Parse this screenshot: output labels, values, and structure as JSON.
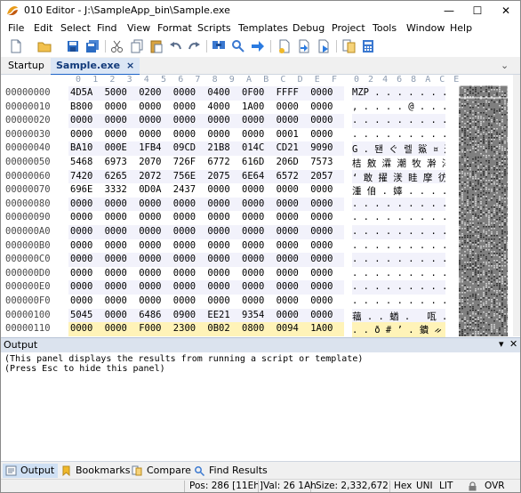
{
  "window": {
    "title": "010 Editor - J:\\SampleApp_bin\\Sample.exe",
    "minimize_glyph": "—",
    "maximize_glyph": "☐",
    "close_glyph": "✕"
  },
  "menu": [
    "File",
    "Edit",
    "Select",
    "Find",
    "View",
    "Format",
    "Scripts",
    "Templates",
    "Debug",
    "Project",
    "Tools",
    "Window",
    "Help"
  ],
  "toolbar_icons": [
    "new-file-icon",
    "open-folder-icon",
    "save-icon",
    "save-all-icon",
    "cut-icon",
    "copy-icon",
    "paste-icon",
    "undo-icon",
    "redo-icon",
    "find-icon",
    "find-in-files-icon",
    "goto-icon",
    "insert-template-icon",
    "run-template-icon",
    "run-script-icon",
    "compare-icon",
    "calculator-icon"
  ],
  "tabs": {
    "startup": "Startup",
    "active": "Sample.exe",
    "close_glyph": "×",
    "chevron": "⌄"
  },
  "hex": {
    "column_header": [
      "0",
      "1",
      "2",
      "3",
      "4",
      "5",
      "6",
      "7",
      "8",
      "9",
      "A",
      "B",
      "C",
      "D",
      "E",
      "F"
    ],
    "text_header": "0 2 4 6 8 A C E",
    "rows": [
      {
        "addr": "00000000",
        "words": [
          "4D5A",
          "5000",
          "0200",
          "0000",
          "0400",
          "0F00",
          "FFFF",
          "0000"
        ],
        "text": "MZP . . . . . . ."
      },
      {
        "addr": "00000010",
        "words": [
          "B800",
          "0000",
          "0000",
          "0000",
          "4000",
          "1A00",
          "0000",
          "0000"
        ],
        "text": ", . . . . @ . . . ."
      },
      {
        "addr": "00000020",
        "words": [
          "0000",
          "0000",
          "0000",
          "0000",
          "0000",
          "0000",
          "0000",
          "0000"
        ],
        "text": ". . . . . . . . . ."
      },
      {
        "addr": "00000030",
        "words": [
          "0000",
          "0000",
          "0000",
          "0000",
          "0000",
          "0000",
          "0001",
          "0000"
        ],
        "text": ". . . . . . . . . ."
      },
      {
        "addr": "00000040",
        "words": [
          "BA10",
          "000E",
          "1FB4",
          "09CD",
          "21B8",
          "014C",
          "CD21",
          "9090"
        ],
        "text": "G . 됀 ぐ 렐 鯊 ¤ 逦"
      },
      {
        "addr": "00000050",
        "words": [
          "5468",
          "6973",
          "2070",
          "726F",
          "6772",
          "616D",
          "206D",
          "7573"
        ],
        "text": "桔 敫 瀮 潮 牧 澣 淬 獵"
      },
      {
        "addr": "00000060",
        "words": [
          "7420",
          "6265",
          "2072",
          "756E",
          "2075",
          "6E64",
          "6572",
          "2057"
        ],
        "text": "‘ 敢 擢 湵 眭 摩 彷 丸"
      },
      {
        "addr": "00000070",
        "words": [
          "696E",
          "3332",
          "0D0A",
          "2437",
          "0000",
          "0000",
          "0000",
          "0000"
        ],
        "text": "湩 㑑 . 嫴 . . . ."
      },
      {
        "addr": "00000080",
        "words": [
          "0000",
          "0000",
          "0000",
          "0000",
          "0000",
          "0000",
          "0000",
          "0000"
        ],
        "text": ". . . . . . . . . ."
      },
      {
        "addr": "00000090",
        "words": [
          "0000",
          "0000",
          "0000",
          "0000",
          "0000",
          "0000",
          "0000",
          "0000"
        ],
        "text": ". . . . . . . . . ."
      },
      {
        "addr": "000000A0",
        "words": [
          "0000",
          "0000",
          "0000",
          "0000",
          "0000",
          "0000",
          "0000",
          "0000"
        ],
        "text": ". . . . . . . . . ."
      },
      {
        "addr": "000000B0",
        "words": [
          "0000",
          "0000",
          "0000",
          "0000",
          "0000",
          "0000",
          "0000",
          "0000"
        ],
        "text": ". . . . . . . . . ."
      },
      {
        "addr": "000000C0",
        "words": [
          "0000",
          "0000",
          "0000",
          "0000",
          "0000",
          "0000",
          "0000",
          "0000"
        ],
        "text": ". . . . . . . . . ."
      },
      {
        "addr": "000000D0",
        "words": [
          "0000",
          "0000",
          "0000",
          "0000",
          "0000",
          "0000",
          "0000",
          "0000"
        ],
        "text": ". . . . . . . . . ."
      },
      {
        "addr": "000000E0",
        "words": [
          "0000",
          "0000",
          "0000",
          "0000",
          "0000",
          "0000",
          "0000",
          "0000"
        ],
        "text": ". . . . . . . . . ."
      },
      {
        "addr": "000000F0",
        "words": [
          "0000",
          "0000",
          "0000",
          "0000",
          "0000",
          "0000",
          "0000",
          "0000"
        ],
        "text": ". . . . . . . . . ."
      },
      {
        "addr": "00000100",
        "words": [
          "5045",
          "0000",
          "6486",
          "0900",
          "EE21",
          "9354",
          "0000",
          "0000"
        ],
        "text": "䕐 . . 蝤 . ￼ 咓 . ."
      },
      {
        "addr": "00000110",
        "words": [
          "0000",
          "0000",
          "F000",
          "2300",
          "0B02",
          "0800",
          "0094",
          "1A00"
        ],
        "text": ". . ð # ʼ . 鐀 ᨀ"
      }
    ]
  },
  "output": {
    "title": "Output",
    "pin_glyph": "▾",
    "close_glyph": "✕",
    "lines": [
      "(This panel displays the results from running a script or template)",
      "(Press Esc to hide this panel)"
    ]
  },
  "bottom_tabs": [
    "Output",
    "Bookmarks",
    "Compare",
    "Find Results"
  ],
  "status": {
    "pos": "Pos: 286 [11Eh]",
    "val": "Val: 26 1Ah",
    "size": "Size: 2,332,672",
    "hex": "Hex",
    "uni": "UNI",
    "lit": "LIT",
    "lock_icon": "lock-icon",
    "ovr": "OVR"
  }
}
